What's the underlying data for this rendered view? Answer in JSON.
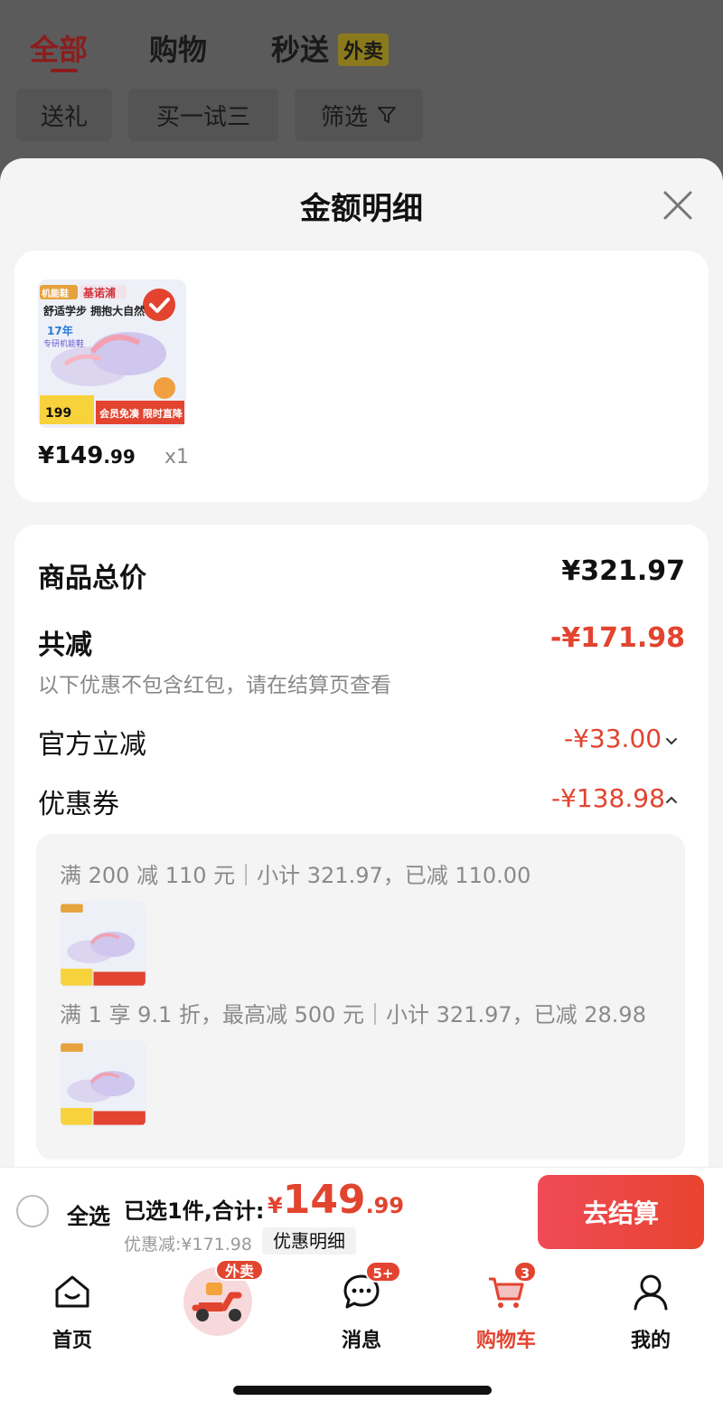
{
  "background_tabs": {
    "all": "全部",
    "shopping": "购物",
    "flash": "秒送",
    "takeout_tag": "外卖"
  },
  "filter_chips": {
    "gift": "送礼",
    "buy_one_try_three": "买一试三",
    "filter": "筛选"
  },
  "sheet": {
    "title": "金额明细"
  },
  "product": {
    "image_brand": "基诺浦",
    "image_category": "机能鞋",
    "image_slogan": "舒适学步 拥抱大自然",
    "image_years": "17年",
    "image_years_sub": "专研机能鞋",
    "image_price": "199",
    "image_promo": "会员免凑 限时直降",
    "price_int": "¥149",
    "price_dec": ".99",
    "qty": "x1"
  },
  "breakdown": {
    "total_label": "商品总价",
    "total_value": "¥321.97",
    "reduce_label": "共减",
    "reduce_value": "-¥171.98",
    "reduce_note": "以下优惠不包含红包，请在结算页查看",
    "official_label": "官方立减",
    "official_value": "-¥33.00",
    "coupon_label": "优惠券",
    "coupon_value": "-¥138.98"
  },
  "coupons": [
    {
      "text": "满 200 减 110 元｜小计 321.97，已减 110.00"
    },
    {
      "text": "满 1 享 9.1 折，最高减 500 元｜小计 321.97，已减 28.98"
    }
  ],
  "footer": {
    "select_all": "全选",
    "summary": "已选1件,合计:",
    "currency": "¥",
    "total_int": "149",
    "total_dec": ".99",
    "discount": "优惠减:¥171.98",
    "detail": "优惠明细",
    "checkout": "去结算"
  },
  "tabbar": {
    "home": "首页",
    "takeout_badge": "外卖",
    "messages": "消息",
    "messages_badge": "5+",
    "cart": "购物车",
    "cart_badge": "3",
    "mine": "我的"
  },
  "colors": {
    "accent_red": "#e2442f",
    "checkout_gradient_start": "#ef4a57",
    "sheet_bg": "#f4f4f4",
    "overlay_bg": "#5b5b5b"
  }
}
